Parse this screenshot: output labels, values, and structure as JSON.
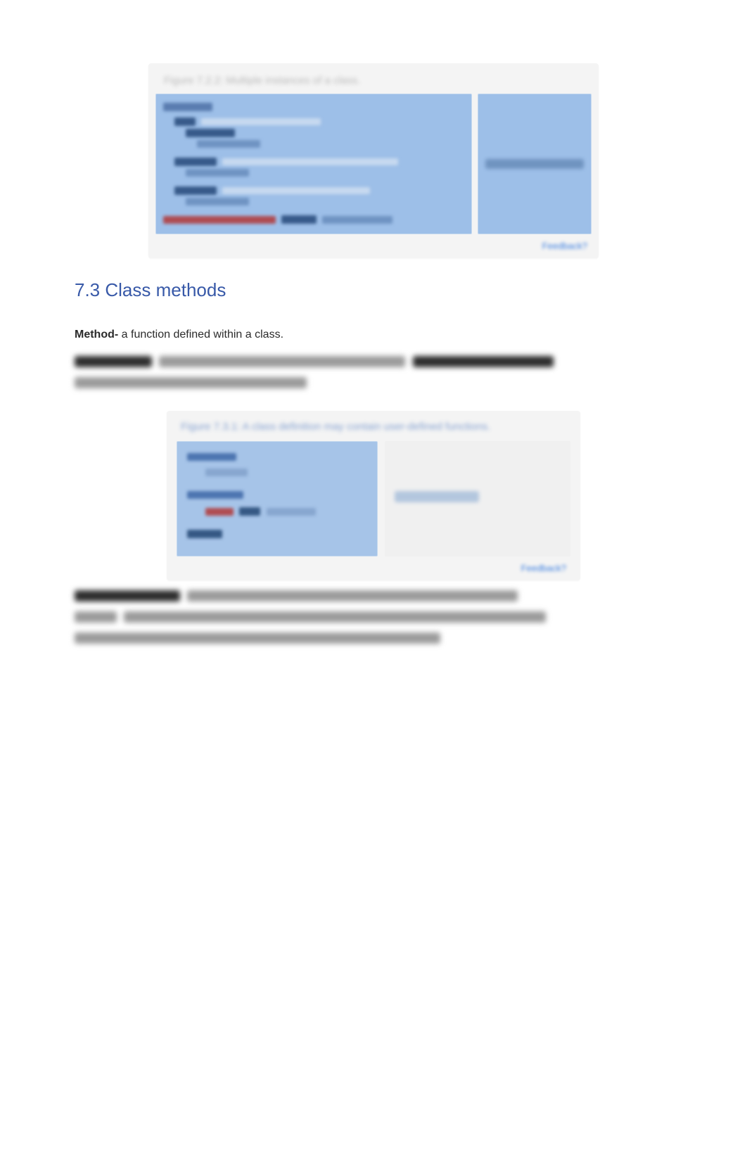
{
  "figure1": {
    "caption": "Figure 7.2.2: Multiple instances of a class.",
    "right_output": "40 feet 20 inches",
    "code_block1_header": "class Time:",
    "code_comment_1": "Create time object self.hrs = 0",
    "code_comment_2": "returns a string representation of obj",
    "feedback_label": "Feedback?"
  },
  "section_heading": "7.3 Class methods",
  "method_def": {
    "term": "Method-",
    "text": " a function defined within a class."
  },
  "paragraph2_line1_bold": "Method Object",
  "paragraph2_line1_rest": " the python object that encapsulates the method's code. A method object is an attribute",
  "paragraph2_line2": "of a class and can be referenced using dot notation.",
  "figure2": {
    "caption": "Figure 7.3.1: A class definition may contain user-defined functions.",
    "right_output": "Area: 132.665 sq",
    "feedback_label": "Feedback?"
  },
  "paragraph3_lead_bold": "Special method names",
  "paragraph3_line1_rest": " methods that implement some special behavior of the class. In the case of",
  "paragraph3_line2": "__init__, the special behavior is the initialization of new instances. Special method names can always",
  "paragraph3_line3": "be identified by the double underscores that appear before and after an identifier."
}
